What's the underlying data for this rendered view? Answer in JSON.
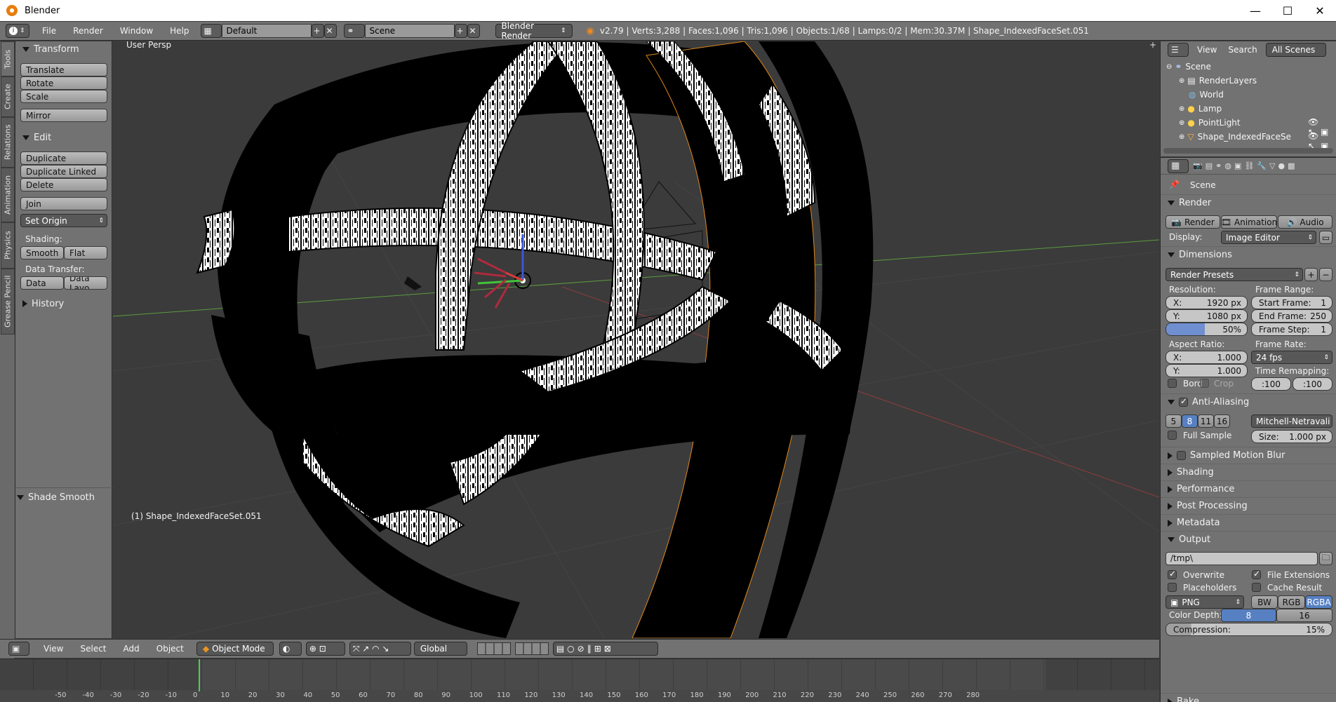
{
  "window": {
    "title": "Blender",
    "min": "—",
    "max": "☐",
    "close": "✕"
  },
  "info": {
    "menus": [
      "File",
      "Render",
      "Window",
      "Help"
    ],
    "screen_layout": "Default",
    "scene": "Scene",
    "engine": "Blender Render",
    "stats": "v2.79 | Verts:3,288 | Faces:1,096 | Tris:1,096 | Objects:1/68 | Lamps:0/2 | Mem:30.37M | Shape_IndexedFaceSet.051"
  },
  "tool_tabs": [
    "Tools",
    "Create",
    "Relations",
    "Animation",
    "Physics",
    "Grease Pencil"
  ],
  "tool_shelf": {
    "transform": {
      "title": "Transform",
      "buttons": [
        "Translate",
        "Rotate",
        "Scale",
        "Mirror"
      ]
    },
    "edit": {
      "title": "Edit",
      "buttons": [
        "Duplicate",
        "Duplicate Linked",
        "Delete",
        "Join",
        "Set Origin"
      ],
      "shading_label": "Shading:",
      "smooth": "Smooth",
      "flat": "Flat",
      "data_transfer_label": "Data Transfer:",
      "data": "Data",
      "data_layout": "Data Layo"
    },
    "history": "History",
    "operator": "Shade Smooth"
  },
  "viewport": {
    "view_label": "User Persp",
    "object_label": "(1) Shape_IndexedFaceSet.051"
  },
  "view3d_header": {
    "menus": [
      "View",
      "Select",
      "Add",
      "Object"
    ],
    "mode": "Object Mode",
    "orientation": "Global"
  },
  "timeline": {
    "ticks": [
      -50,
      -40,
      -30,
      -20,
      -10,
      0,
      10,
      20,
      30,
      40,
      50,
      60,
      70,
      80,
      90,
      100,
      110,
      120,
      130,
      140,
      150,
      160,
      170,
      180,
      190,
      200,
      210,
      220,
      230,
      240,
      250,
      260,
      270,
      280
    ],
    "current_frame": 0
  },
  "outliner": {
    "view": "View",
    "search": "Search",
    "filter": "All Scenes",
    "items": [
      "Scene",
      "RenderLayers",
      "World",
      "Lamp",
      "PointLight",
      "Shape_IndexedFaceSet"
    ]
  },
  "properties": {
    "context": "Scene",
    "render": {
      "title": "Render",
      "render_btn": "Render",
      "animation_btn": "Animation",
      "audio_btn": "Audio",
      "display_label": "Display:",
      "display_value": "Image Editor"
    },
    "dimensions": {
      "title": "Dimensions",
      "presets": "Render Presets",
      "resolution_label": "Resolution:",
      "x": "X:",
      "x_val": "1920 px",
      "y": "Y:",
      "y_val": "1080 px",
      "percent": "50%",
      "frame_range_label": "Frame Range:",
      "start": "Start Frame:",
      "start_val": "1",
      "end": "End Frame:",
      "end_val": "250",
      "step": "Frame Step:",
      "step_val": "1",
      "aspect_label": "Aspect Ratio:",
      "ax": "X:",
      "ax_val": "1.000",
      "ay": "Y:",
      "ay_val": "1.000",
      "frame_rate_label": "Frame Rate:",
      "fps": "24 fps",
      "time_remap_label": "Time Remapping:",
      "remap_old": ":100",
      "remap_new": ":100",
      "bord": "Bord",
      "crop": "Crop"
    },
    "antialiasing": {
      "title": "Anti-Aliasing",
      "samples": [
        "5",
        "8",
        "11",
        "16"
      ],
      "selected": "8",
      "filter": "Mitchell-Netravali",
      "full_sample": "Full Sample",
      "size": "Size:",
      "size_val": "1.000 px"
    },
    "sampled_motion_blur": "Sampled Motion Blur",
    "collapsed": [
      "Shading",
      "Performance",
      "Post Processing",
      "Metadata"
    ],
    "output": {
      "title": "Output",
      "path": "/tmp\\",
      "overwrite": "Overwrite",
      "file_extensions": "File Extensions",
      "placeholders": "Placeholders",
      "cache_result": "Cache Result",
      "format": "PNG",
      "bw": "BW",
      "rgb": "RGB",
      "rgba": "RGBA",
      "color_depth_label": "Color Depth:",
      "depth8": "8",
      "depth16": "16",
      "compression_label": "Compression:",
      "compression_val": "15%"
    },
    "bake": "Bake"
  }
}
